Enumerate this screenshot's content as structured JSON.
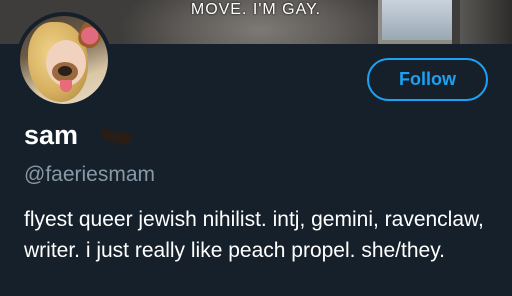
{
  "banner": {
    "caption": "MOVE. I'M GAY."
  },
  "profile": {
    "display_name": "sam",
    "handle": "@faeriesmam",
    "name_emoji": "ant-icon",
    "bio": "flyest queer jewish nihilist. intj, gemini, ravenclaw, writer. i just really like peach propel. she/they."
  },
  "actions": {
    "follow_label": "Follow"
  },
  "colors": {
    "background": "#15202b",
    "accent": "#1da1f2",
    "secondary_text": "#8899a6"
  }
}
